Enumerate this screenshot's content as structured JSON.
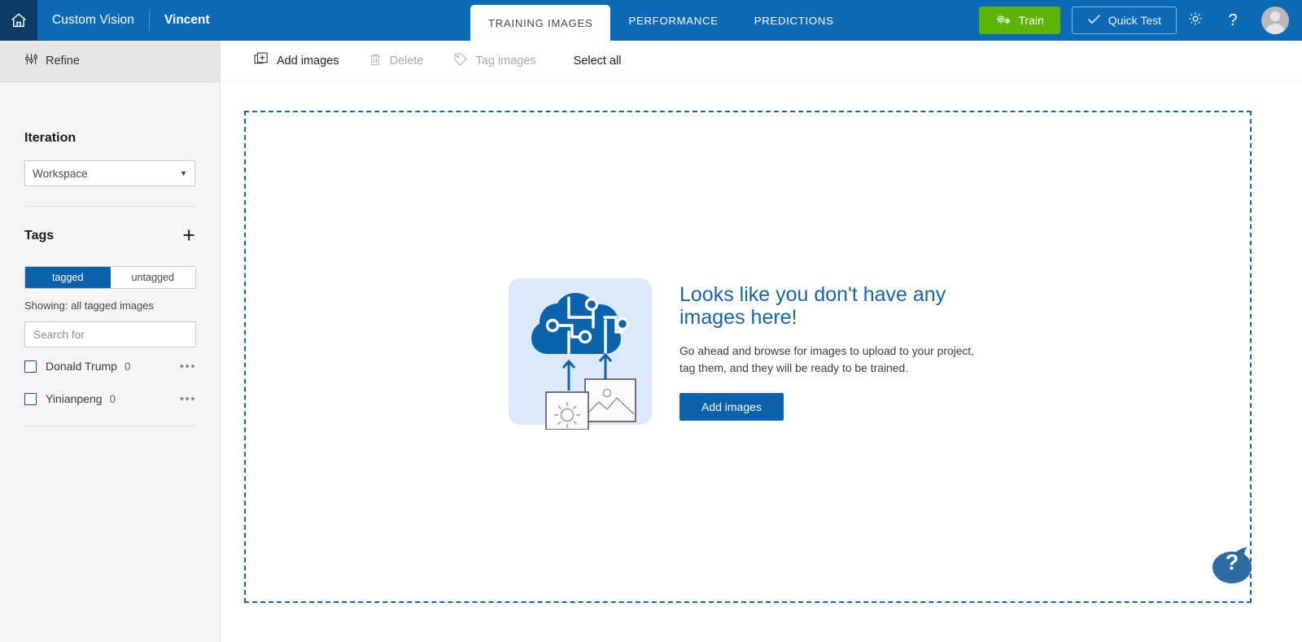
{
  "header": {
    "home_icon": "home-icon",
    "app_name": "Custom Vision",
    "project_name": "Vincent",
    "tabs": [
      {
        "label": "TRAINING IMAGES",
        "active": true
      },
      {
        "label": "PERFORMANCE",
        "active": false
      },
      {
        "label": "PREDICTIONS",
        "active": false
      }
    ],
    "train_button": {
      "label": "Train",
      "icon": "gears-icon",
      "color": "#5cb300"
    },
    "quick_test_button": {
      "label": "Quick Test",
      "icon": "check-icon"
    },
    "settings_icon": "gear-icon",
    "help_icon": "question-mark-icon",
    "avatar": "user-avatar",
    "background_color": "#0c69b5",
    "home_background_color": "#0b3c66"
  },
  "sidebar": {
    "refine": {
      "label": "Refine",
      "icon": "sliders-icon"
    },
    "iteration": {
      "title": "Iteration",
      "select_value": "Workspace",
      "caret_icon": "chevron-down-icon"
    },
    "tags": {
      "title": "Tags",
      "add_icon": "plus-icon",
      "filter": {
        "tagged": "tagged",
        "untagged": "untagged",
        "active": "tagged"
      },
      "showing_text": "Showing: all tagged images",
      "search_placeholder": "Search for",
      "search_value": "",
      "items": [
        {
          "name": "Donald Trump",
          "count": "0",
          "checked": false,
          "menu_icon": "more-options-icon"
        },
        {
          "name": "Yinianpeng",
          "count": "0",
          "checked": false,
          "menu_icon": "more-options-icon"
        }
      ]
    }
  },
  "toolbar": {
    "add_images": {
      "label": "Add images",
      "icon": "add-image-icon",
      "enabled": true
    },
    "delete": {
      "label": "Delete",
      "icon": "trash-icon",
      "enabled": false
    },
    "tag_images": {
      "label": "Tag images",
      "icon": "tag-icon",
      "enabled": false
    },
    "select_all": {
      "label": "Select all",
      "enabled": true
    }
  },
  "main": {
    "dropzone_border_color": "#1565a8",
    "illustration": "cloud-ai-upload-illustration",
    "empty_title": "Looks like you don't have any images here!",
    "empty_subtitle": "Go ahead and browse for images to upload to your project, tag them, and they will be ready to be trained.",
    "add_images_button": "Add images",
    "help_fab": "help-chat-icon"
  },
  "colors": {
    "accent_blue": "#0b61ab",
    "header_blue": "#0c69b5",
    "train_green": "#5cb300",
    "title_blue": "#1b63a5"
  }
}
